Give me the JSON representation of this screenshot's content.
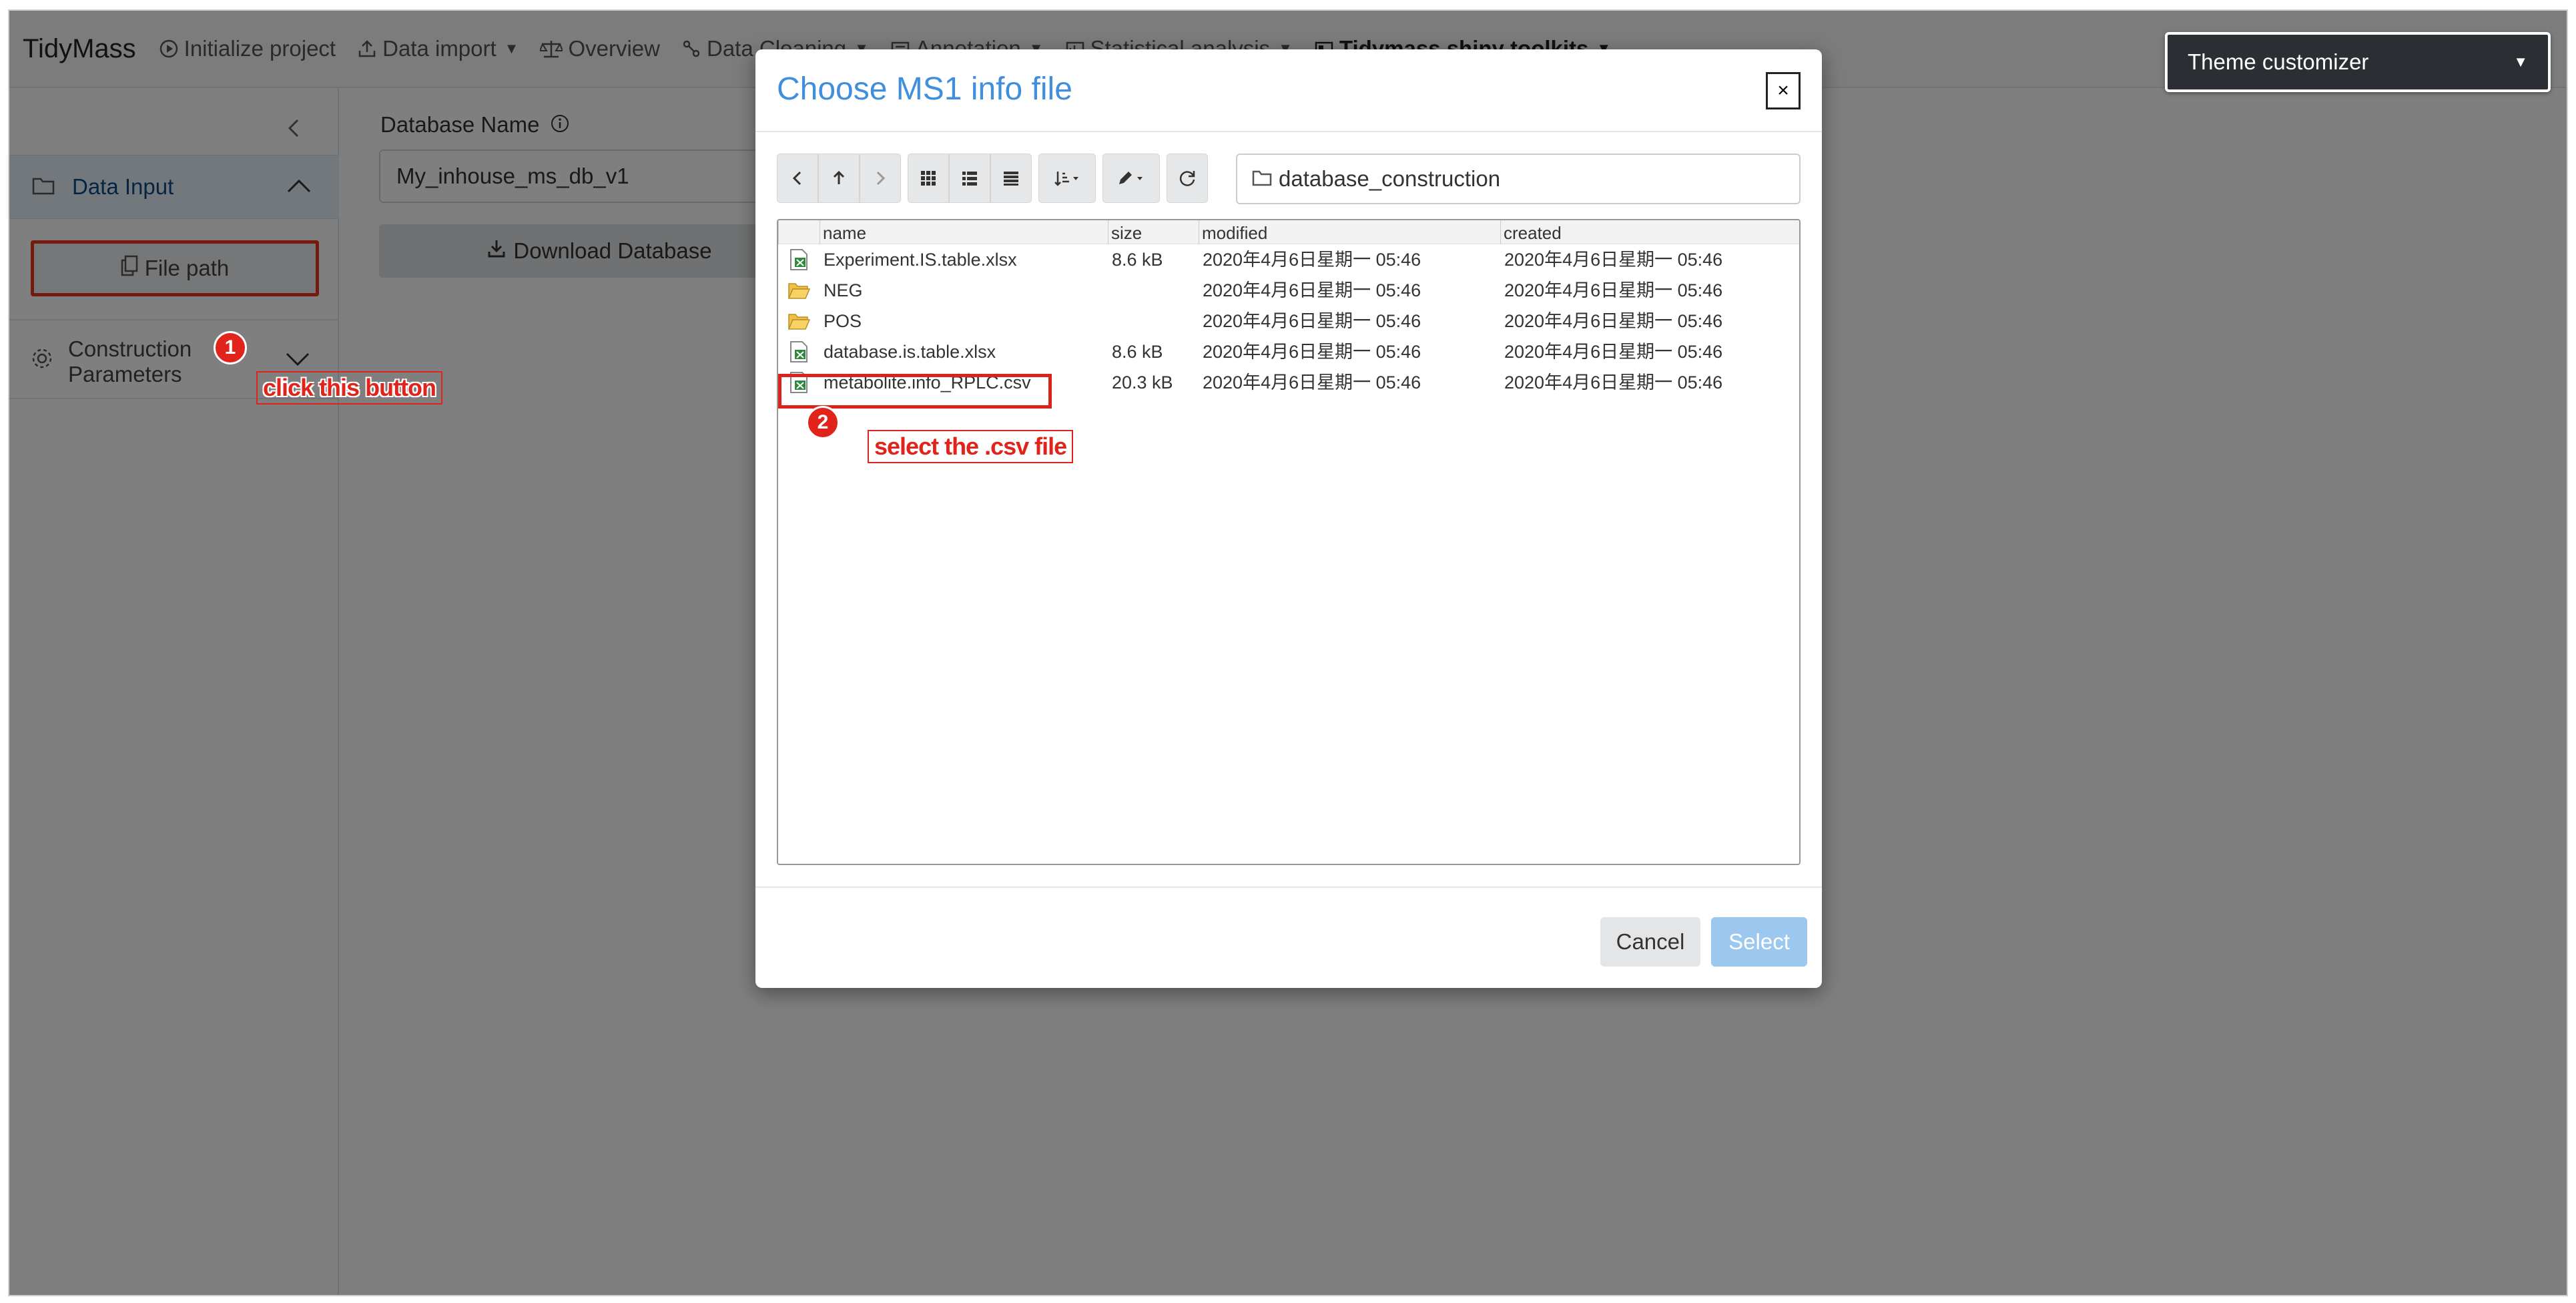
{
  "navbar": {
    "brand": "TidyMass",
    "items": [
      {
        "label": "Initialize project",
        "icon": "play-circle-icon"
      },
      {
        "label": "Data import",
        "icon": "upload-icon"
      },
      {
        "label": "Overview",
        "icon": "balance-scale-icon"
      },
      {
        "label": "Data Cleaning",
        "icon": "broom-icon"
      },
      {
        "label": "Annotation",
        "icon": "tag-icon"
      },
      {
        "label": "Statistical analysis",
        "icon": "chart-icon"
      },
      {
        "label": "Tidymass shiny toolkits",
        "icon": "toolbox-icon"
      }
    ]
  },
  "theme_customizer": {
    "label": "Theme customizer"
  },
  "sidebar": {
    "data_input": {
      "label": "Data Input",
      "icon": "folder-icon"
    },
    "file_path_button": {
      "label": "File path",
      "icon": "copy-icon"
    },
    "construction": {
      "label": "Construction Parameters",
      "icon": "gear-icon"
    }
  },
  "main": {
    "db_name_label": "Database Name",
    "db_name_value": "My_inhouse_ms_db_v1",
    "download_label": "Download Database"
  },
  "annotations": {
    "step1_number": "1",
    "step1_text": "click this button",
    "step2_number": "2",
    "step2_text": "select the .csv file"
  },
  "modal": {
    "title": "Choose MS1 info file",
    "close": "×",
    "path": "database_construction",
    "columns": {
      "name": "name",
      "size": "size",
      "modified": "modified",
      "created": "created"
    },
    "files": [
      {
        "name": "Experiment.IS.table.xlsx",
        "size": "8.6 kB",
        "modified": "2020年4月6日星期一 05:46",
        "created": "2020年4月6日星期一 05:46",
        "type": "file"
      },
      {
        "name": "NEG",
        "size": "",
        "modified": "2020年4月6日星期一 05:46",
        "created": "2020年4月6日星期一 05:46",
        "type": "folder"
      },
      {
        "name": "POS",
        "size": "",
        "modified": "2020年4月6日星期一 05:46",
        "created": "2020年4月6日星期一 05:46",
        "type": "folder"
      },
      {
        "name": "database.is.table.xlsx",
        "size": "8.6 kB",
        "modified": "2020年4月6日星期一 05:46",
        "created": "2020年4月6日星期一 05:46",
        "type": "file"
      },
      {
        "name": "metabolite.info_RPLC.csv",
        "size": "20.3 kB",
        "modified": "2020年4月6日星期一 05:46",
        "created": "2020年4月6日星期一 05:46",
        "type": "file"
      }
    ],
    "cancel_label": "Cancel",
    "select_label": "Select"
  },
  "colors": {
    "accent": "#3f8fdc",
    "annotation_red": "#e0241b",
    "theme_dark": "#2b2f33",
    "select_disabled": "#9cc7ef"
  }
}
